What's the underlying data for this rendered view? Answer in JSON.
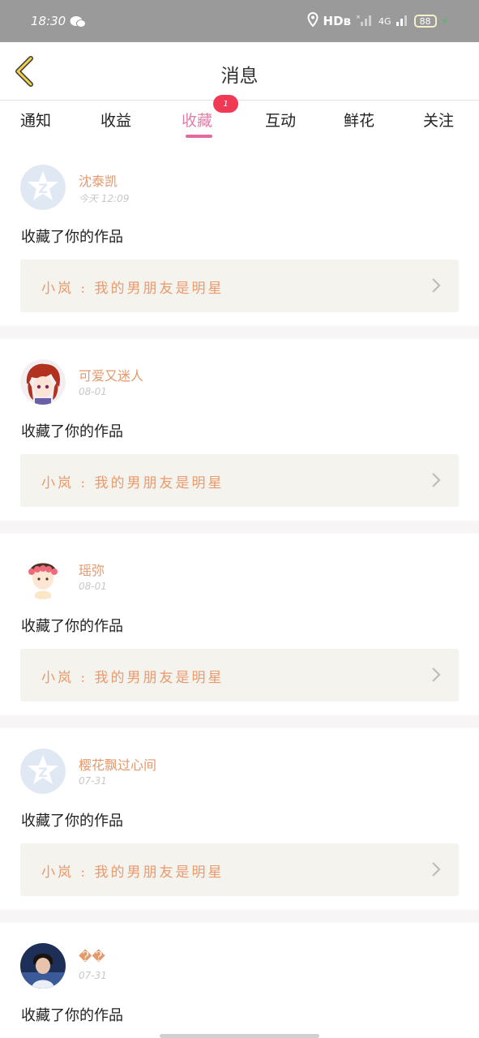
{
  "status": {
    "time": "18:30",
    "hd": "HDв",
    "network": "4G",
    "battery": "88"
  },
  "header": {
    "title": "消息"
  },
  "tabs": [
    {
      "label": "通知"
    },
    {
      "label": "收益"
    },
    {
      "label": "收藏",
      "badge": "1",
      "active": true
    },
    {
      "label": "互动"
    },
    {
      "label": "鲜花"
    },
    {
      "label": "关注"
    }
  ],
  "notifications": [
    {
      "name": "沈泰凯",
      "time": "今天 12:09",
      "action": "收藏了你的作品",
      "work": "小岚 : 我的男朋友是明星",
      "avatar": "qq-default-avatar"
    },
    {
      "name": "可爱又迷人",
      "time": "08-01",
      "action": "收藏了你的作品",
      "work": "小岚 : 我的男朋友是明星",
      "avatar": "red-hair-avatar"
    },
    {
      "name": "瑶弥",
      "time": "08-01",
      "action": "收藏了你的作品",
      "work": "小岚 : 我的男朋友是明星",
      "avatar": "flower-crown-avatar"
    },
    {
      "name": "樱花飘过心间",
      "time": "07-31",
      "action": "收藏了你的作品",
      "work": "小岚 : 我的男朋友是明星",
      "avatar": "qq-default-avatar"
    },
    {
      "name": "��",
      "time": "07-31",
      "action": "收藏了你的作品",
      "work": "",
      "avatar": "photo-avatar"
    }
  ],
  "colors": {
    "accent": "#e26aa0",
    "name": "#e4996c",
    "badge": "#f03a55",
    "card_bg": "#f4f3ee"
  }
}
